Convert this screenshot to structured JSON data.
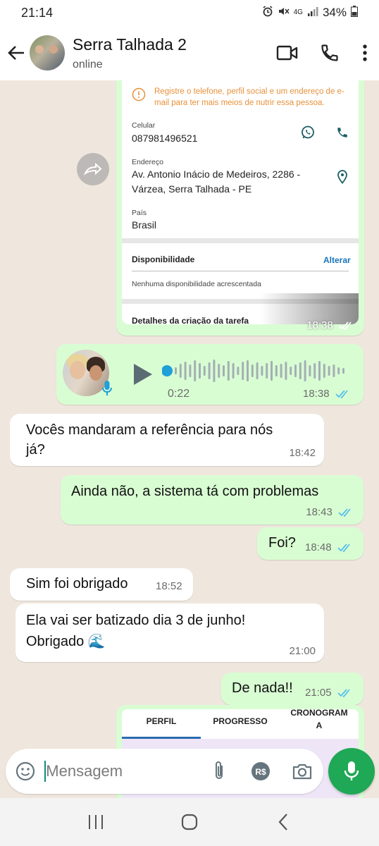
{
  "status_bar": {
    "time": "21:14",
    "network": "4G",
    "battery": "34%"
  },
  "header": {
    "title": "Serra Talhada 2",
    "status": "online",
    "icons": [
      "back-arrow-icon",
      "video-call-icon",
      "phone-icon",
      "more-vert-icon"
    ]
  },
  "image_card": {
    "notice": "Registre o telefone, perfil social e um endereço de e-mail para ter mais meios de nutrir essa pessoa.",
    "phone_label": "Celular",
    "phone_value": "087981496521",
    "address_label": "Endereço",
    "address_line1": "Av. Antonio Inácio de Medeiros, 2286 -",
    "address_line2": "Várzea, Serra Talhada - PE",
    "country_label": "País",
    "country_value": "Brasil",
    "availability_title": "Disponibilidade",
    "availability_action": "Alterar",
    "availability_note": "Nenhuma disponibilidade acrescentada",
    "task_details_title": "Detalhes da criação da tarefa",
    "time": "18:38"
  },
  "voice_message": {
    "duration": "0:22",
    "time": "18:38"
  },
  "messages": [
    {
      "direction": "in",
      "line1": "Vocês mandaram a referência para nós",
      "line2": "já?",
      "time": "18:42"
    },
    {
      "direction": "out",
      "text": "Ainda não,  a sistema tá com problemas",
      "time": "18:43"
    },
    {
      "direction": "out",
      "text": "Foi?",
      "time": "18:48"
    },
    {
      "direction": "in",
      "text": "Sim foi obrigado",
      "time": "18:52"
    },
    {
      "direction": "in",
      "line1": "Ela vai ser batizado dia 3 de junho!",
      "line2": "Obrigado 🌊",
      "time": "21:00"
    },
    {
      "direction": "out",
      "text": "De nada!!",
      "time": "21:05"
    }
  ],
  "tabs_card": {
    "tabs": [
      "PERFIL",
      "PROGRESSO",
      "CRONOGRAM",
      "A"
    ]
  },
  "input": {
    "placeholder": "Mensagem"
  },
  "colors": {
    "outgoing_bubble": "#d9fdd3",
    "incoming_bubble": "#ffffff",
    "accent_green": "#1fa855",
    "read_ticks": "#53bdeb",
    "chat_background": "#efe7de"
  }
}
